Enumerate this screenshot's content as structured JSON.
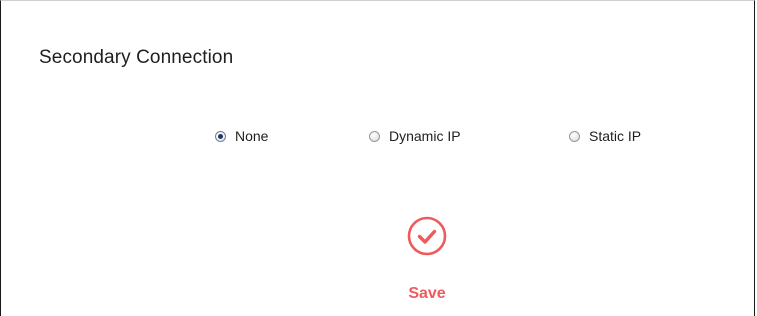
{
  "section": {
    "title": "Secondary Connection"
  },
  "connection_type": {
    "selected": "None",
    "options": [
      {
        "label": "None",
        "checked": true
      },
      {
        "label": "Dynamic IP",
        "checked": false
      },
      {
        "label": "Static IP",
        "checked": false
      }
    ]
  },
  "actions": {
    "save_label": "Save",
    "save_icon": "checkmark-circle-icon",
    "accent_color": "#ef5b5b"
  }
}
